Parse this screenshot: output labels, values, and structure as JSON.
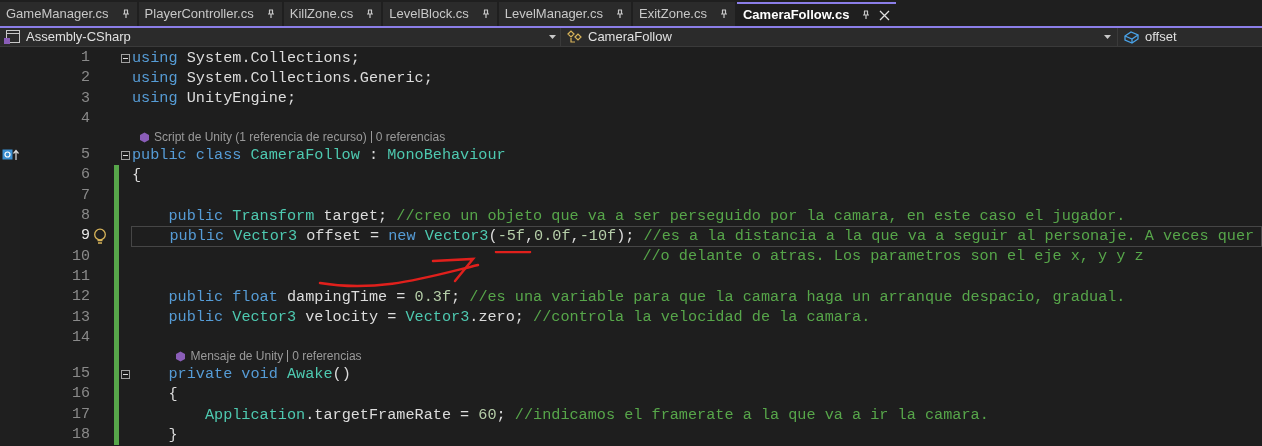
{
  "tabs": [
    {
      "label": "GameManager.cs",
      "selected": false
    },
    {
      "label": "PlayerController.cs",
      "selected": false
    },
    {
      "label": "KillZone.cs",
      "selected": false
    },
    {
      "label": "LevelBlock.cs",
      "selected": false
    },
    {
      "label": "LevelManager.cs",
      "selected": false
    },
    {
      "label": "ExitZone.cs",
      "selected": false
    },
    {
      "label": "CameraFollow.cs",
      "selected": true
    }
  ],
  "navigation_bar": {
    "project": "Assembly-CSharp",
    "type": "CameraFollow",
    "member": "offset"
  },
  "editor": {
    "lines": [
      {
        "number": "1",
        "fold": true,
        "modified": false,
        "current": false,
        "lightbulb": false,
        "implements_marker": false,
        "tokens": [
          {
            "kind": "keyword",
            "text": "using"
          },
          {
            "kind": "plain",
            "text": " System.Collections;"
          }
        ]
      },
      {
        "number": "2",
        "fold": false,
        "modified": false,
        "current": false,
        "lightbulb": false,
        "implements_marker": false,
        "tokens": [
          {
            "kind": "keyword",
            "text": "using"
          },
          {
            "kind": "plain",
            "text": " System.Collections.Generic;"
          }
        ]
      },
      {
        "number": "3",
        "fold": false,
        "modified": false,
        "current": false,
        "lightbulb": false,
        "implements_marker": false,
        "tokens": [
          {
            "kind": "keyword",
            "text": "using"
          },
          {
            "kind": "plain",
            "text": " UnityEngine;"
          }
        ]
      },
      {
        "number": "4",
        "fold": false,
        "modified": false,
        "current": false,
        "lightbulb": false,
        "implements_marker": false
      },
      {
        "number": "5",
        "fold": true,
        "modified": false,
        "current": false,
        "lightbulb": false,
        "implements_marker": true,
        "codelens": [
          "Script de Unity (1 referencia de recurso)",
          "0 referencias"
        ],
        "tokens": [
          {
            "kind": "keyword",
            "text": "public class "
          },
          {
            "kind": "type",
            "text": "CameraFollow"
          },
          {
            "kind": "plain",
            "text": " : "
          },
          {
            "kind": "type",
            "text": "MonoBehaviour"
          }
        ]
      },
      {
        "number": "6",
        "fold": false,
        "modified": true,
        "current": false,
        "lightbulb": false,
        "implements_marker": false,
        "tokens": [
          {
            "kind": "plain",
            "text": "{"
          }
        ]
      },
      {
        "number": "7",
        "fold": false,
        "modified": true,
        "current": false,
        "lightbulb": false,
        "implements_marker": false
      },
      {
        "number": "8",
        "fold": false,
        "modified": true,
        "current": false,
        "lightbulb": false,
        "implements_marker": false,
        "tokens": [
          {
            "kind": "keyword",
            "text": "    public "
          },
          {
            "kind": "type",
            "text": "Transform"
          },
          {
            "kind": "plain",
            "text": " target; "
          },
          {
            "kind": "comment",
            "text": "//creo un objeto que va a ser perseguido por la camara, en este caso el jugador."
          }
        ]
      },
      {
        "number": "9",
        "fold": false,
        "modified": true,
        "current": true,
        "lightbulb": true,
        "implements_marker": false,
        "tokens": [
          {
            "kind": "keyword",
            "text": "    public "
          },
          {
            "kind": "type",
            "text": "Vector3"
          },
          {
            "kind": "plain",
            "text": " offset = "
          },
          {
            "kind": "keyword",
            "text": "new "
          },
          {
            "kind": "type",
            "text": "Vector3"
          },
          {
            "kind": "plain",
            "text": "("
          },
          {
            "kind": "number",
            "text": "-5f"
          },
          {
            "kind": "plain",
            "text": ","
          },
          {
            "kind": "number",
            "text": "0.0f"
          },
          {
            "kind": "plain",
            "text": ","
          },
          {
            "kind": "number",
            "text": "-10f"
          },
          {
            "kind": "plain",
            "text": "); "
          },
          {
            "kind": "comment",
            "text": "//es a la distancia a la que va a seguir al personaje. A veces quer"
          }
        ]
      },
      {
        "number": "10",
        "fold": false,
        "modified": true,
        "current": false,
        "lightbulb": false,
        "implements_marker": false,
        "tokens": [
          {
            "kind": "comment",
            "text": "                                                        //o delante o atras. Los parametros son el eje x, y y z"
          }
        ]
      },
      {
        "number": "11",
        "fold": false,
        "modified": true,
        "current": false,
        "lightbulb": false,
        "implements_marker": false
      },
      {
        "number": "12",
        "fold": false,
        "modified": true,
        "current": false,
        "lightbulb": false,
        "implements_marker": false,
        "tokens": [
          {
            "kind": "keyword",
            "text": "    public float "
          },
          {
            "kind": "plain",
            "text": "dampingTime = "
          },
          {
            "kind": "number",
            "text": "0.3f"
          },
          {
            "kind": "plain",
            "text": "; "
          },
          {
            "kind": "comment",
            "text": "//es una variable para que la camara haga un arranque despacio, gradual."
          }
        ]
      },
      {
        "number": "13",
        "fold": false,
        "modified": true,
        "current": false,
        "lightbulb": false,
        "implements_marker": false,
        "tokens": [
          {
            "kind": "keyword",
            "text": "    public "
          },
          {
            "kind": "type",
            "text": "Vector3"
          },
          {
            "kind": "plain",
            "text": " velocity = "
          },
          {
            "kind": "type",
            "text": "Vector3"
          },
          {
            "kind": "plain",
            "text": ".zero; "
          },
          {
            "kind": "comment",
            "text": "//controla la velocidad de la camara."
          }
        ]
      },
      {
        "number": "14",
        "fold": false,
        "modified": true,
        "current": false,
        "lightbulb": false,
        "implements_marker": false
      },
      {
        "number": "15",
        "fold": true,
        "modified": true,
        "current": false,
        "lightbulb": false,
        "implements_marker": false,
        "codelens": [
          "Mensaje de Unity",
          "0 referencias"
        ],
        "tokens": [
          {
            "kind": "keyword",
            "text": "    private void "
          },
          {
            "kind": "type",
            "text": "Awake"
          },
          {
            "kind": "plain",
            "text": "()"
          }
        ]
      },
      {
        "number": "16",
        "fold": false,
        "modified": true,
        "current": false,
        "lightbulb": false,
        "implements_marker": false,
        "tokens": [
          {
            "kind": "plain",
            "text": "    {"
          }
        ]
      },
      {
        "number": "17",
        "fold": false,
        "modified": true,
        "current": false,
        "lightbulb": false,
        "implements_marker": false,
        "tokens": [
          {
            "kind": "type",
            "text": "        Application"
          },
          {
            "kind": "plain",
            "text": ".targetFrameRate = "
          },
          {
            "kind": "number",
            "text": "60"
          },
          {
            "kind": "plain",
            "text": "; "
          },
          {
            "kind": "comment",
            "text": "//indicamos el framerate a la que va a ir la camara."
          }
        ]
      },
      {
        "number": "18",
        "fold": false,
        "modified": true,
        "current": false,
        "lightbulb": false,
        "implements_marker": false,
        "tokens": [
          {
            "kind": "plain",
            "text": "    }"
          }
        ]
      }
    ]
  }
}
